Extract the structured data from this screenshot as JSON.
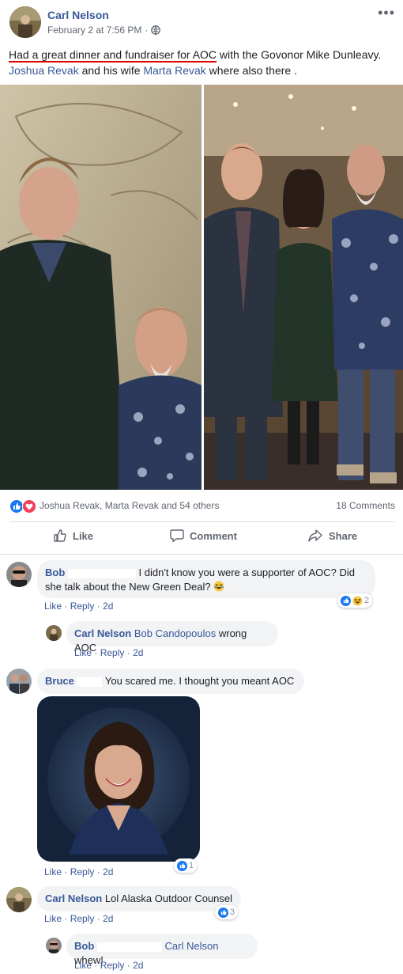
{
  "post": {
    "author": "Carl Nelson",
    "timestamp": "February 2 at 7:56 PM",
    "privacy_sep": "·",
    "menu_icon": "more-icon",
    "text_highlight": "Had a great dinner and fundraiser for AOC",
    "text_rest": " with the Govonor Mike Dunleavy.",
    "tag1": "Joshua Revak",
    "text_mid": " and his wife ",
    "tag2": "Marta Revak",
    "text_end": " where also there ."
  },
  "reactions": {
    "names": "Joshua Revak, Marta Revak and 54 others",
    "comments_count": "18 Comments"
  },
  "actions": {
    "like": "Like",
    "comment": "Comment",
    "share": "Share"
  },
  "comments": [
    {
      "name": "Bob",
      "text1": "I didn't know you were a supporter of AOC? Did",
      "text2": "she talk about the New Green Deal? ",
      "like": "Like",
      "reply": "Reply",
      "time": "2d",
      "reaction_count": "2"
    },
    {
      "name": "Carl Nelson",
      "mention": "Bob Candopoulos",
      "text": " wrong AOC",
      "like": "Like",
      "reply": "Reply",
      "time": "2d"
    },
    {
      "name": "Bruce",
      "text": "You scared me. I thought you meant AOC",
      "like": "Like",
      "reply": "Reply",
      "time": "2d",
      "reaction_count": "1"
    },
    {
      "name": "Carl Nelson",
      "text": "Lol Alaska Outdoor Counsel",
      "like": "Like",
      "reply": "Reply",
      "time": "2d",
      "reaction_count": "3"
    },
    {
      "name": "Bob",
      "mention": "Carl Nelson",
      "text": " whew!",
      "like": "Like",
      "reply": "Reply",
      "time": "2d"
    }
  ],
  "separators": {
    "dot": "·"
  },
  "colors": {
    "link": "#385898",
    "like_blue": "#1877f2",
    "love_red": "#f33e58",
    "underline_red": "#e00000",
    "bubble_bg": "#f2f3f5"
  }
}
